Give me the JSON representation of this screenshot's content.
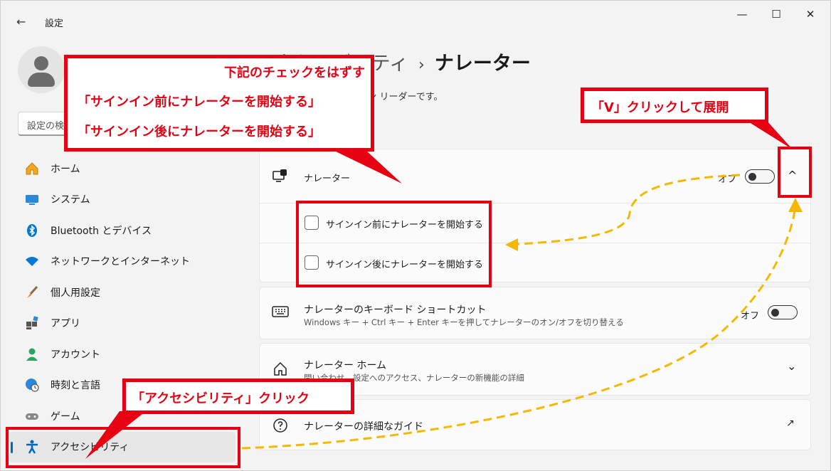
{
  "window": {
    "back_icon": "←",
    "title": "設定",
    "minimize_icon": "—",
    "maximize_icon": "☐",
    "close_icon": "✕"
  },
  "sidebar": {
    "search_placeholder": "設定の検",
    "items": [
      {
        "label": "ホーム",
        "icon": "home-icon"
      },
      {
        "label": "システム",
        "icon": "monitor-icon"
      },
      {
        "label": "Bluetooth とデバイス",
        "icon": "bluetooth-icon"
      },
      {
        "label": "ネットワークとインターネット",
        "icon": "wifi-icon"
      },
      {
        "label": "個人用設定",
        "icon": "brush-icon"
      },
      {
        "label": "アプリ",
        "icon": "apps-icon"
      },
      {
        "label": "アカウント",
        "icon": "person-icon"
      },
      {
        "label": "時刻と言語",
        "icon": "globe-clock-icon"
      },
      {
        "label": "ゲーム",
        "icon": "gamepad-icon"
      },
      {
        "label": "アクセシビリティ",
        "icon": "accessibility-icon",
        "active": true
      }
    ]
  },
  "main": {
    "breadcrumb_parent": "アクセシビリティ",
    "breadcrumb_sep": "›",
    "page_title": "ナレーター",
    "page_desc": "た内容を説明するスクリーン リーダーです。",
    "narrator": {
      "title": "ナレーター",
      "toggle_label": "オフ",
      "toggle_on": false,
      "chevron": "^",
      "options": [
        {
          "label": "サインイン前にナレーターを開始する",
          "checked": false
        },
        {
          "label": "サインイン後にナレーターを開始する",
          "checked": false
        }
      ]
    },
    "shortcut": {
      "title": "ナレーターのキーボード ショートカット",
      "subtitle": "Windows キー + Ctrl キー + Enter キーを押してナレーターのオン/オフを切り替える",
      "toggle_label": "オフ",
      "toggle_on": false
    },
    "home": {
      "title": "ナレーター ホーム",
      "subtitle": "問い合わせ、設定へのアクセス、ナレーターの新機能の詳細",
      "chevron": "⌄"
    },
    "guide": {
      "title": "ナレーターの詳細なガイド",
      "external_icon": "↗"
    }
  },
  "annotations": {
    "instruction": {
      "line1": "下記のチェックをはずす",
      "line2": "「サインイン前にナレーターを開始する」",
      "line3": "「サインイン後にナレーターを開始する」"
    },
    "expand": "「V」クリックして展開",
    "accessibility": "「アクセシビリティ」クリック",
    "color_red": "#e60012",
    "color_arrow": "#f5b800"
  }
}
